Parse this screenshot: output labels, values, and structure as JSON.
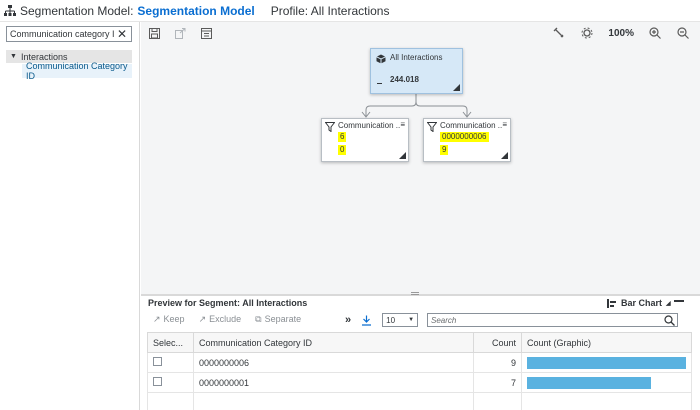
{
  "header": {
    "label": "Segmentation Model:",
    "model_name": "Segmentation Model",
    "profile": "Profile: All Interactions"
  },
  "sidebar": {
    "search_value": "Communication category ID",
    "tree_root": "Interactions",
    "tree_item": "Communication Category ID"
  },
  "canvas": {
    "zoom": "100%",
    "root_node": {
      "title": "All Interactions",
      "value": "244.018"
    },
    "child_nodes": [
      {
        "title": "Communication ...",
        "line1": "6",
        "line2": "0"
      },
      {
        "title": "Communication ...",
        "line1": "0000000006",
        "line2": "9"
      }
    ]
  },
  "preview": {
    "title": "Preview for Segment: All Interactions",
    "bar_chart_label": "Bar Chart",
    "keep": "Keep",
    "exclude": "Exclude",
    "separate": "Separate",
    "more": "»",
    "page_size": "10",
    "search_placeholder": "Search",
    "columns": [
      "Selec...",
      "Communication Category ID",
      "Count",
      "Count (Graphic)"
    ],
    "rows": [
      {
        "id": "0000000006",
        "count": 9,
        "bar_fraction": 1.0
      },
      {
        "id": "0000000001",
        "count": 7,
        "bar_fraction": 0.78
      }
    ]
  },
  "colors": {
    "accent": "#0a6ed1",
    "bar": "#5ab2e0",
    "highlight": "#ffff00"
  }
}
